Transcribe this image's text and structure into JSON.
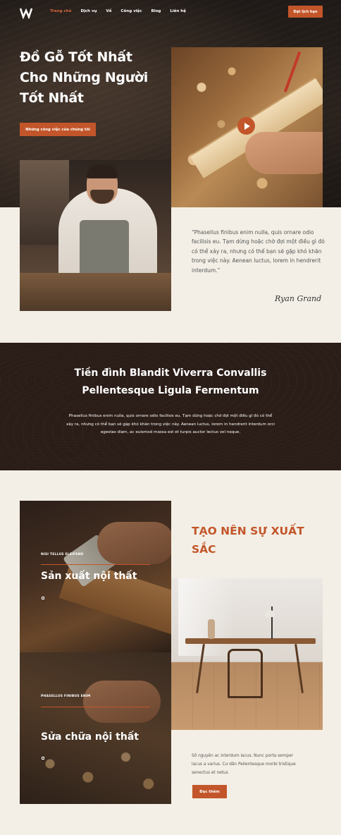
{
  "brand": {
    "logo_letter": "W",
    "accent": "#c2562a"
  },
  "nav": {
    "items": [
      {
        "label": "Trang chủ",
        "active": true
      },
      {
        "label": "Dịch vụ",
        "active": false
      },
      {
        "label": "Về",
        "active": false
      },
      {
        "label": "Công việc",
        "active": false
      },
      {
        "label": "Blog",
        "active": false
      },
      {
        "label": "Liên hệ",
        "active": false
      }
    ],
    "cta_label": "Đặt lịch hẹn"
  },
  "hero": {
    "title": "Đồ Gỗ Tốt Nhất Cho Những Người Tốt Nhất",
    "button_label": "Những công việc của chúng tôi"
  },
  "testimonial": {
    "quote": "“Phasellus finibus enim nulla, quis ornare odio facilisis eu. Tạm dừng hoặc chờ đợi một điều gì đó có thể xảy ra, nhưng có thể bạn sẽ gặp khó khăn trong việc này. Aenean luctus, lorem in hendrerit interdum.”",
    "signature": "Ryan Grand"
  },
  "band": {
    "title": "Tiền đình Blandit Viverra Convallis Pellentesque Ligula Fermentum",
    "text": "Phasellus finibus enim nulla, quis ornare odio facilisis eu. Tạm dừng hoặc chờ đợi một điều gì đó có thể xảy ra, nhưng có thể bạn sẽ gặp khó khăn trong việc này. Aenean luctus, lorem in hendrerit interdum orci egestas diam, ac euismod massa est et turpis auctor lectus vel neque."
  },
  "services": [
    {
      "kicker": "NISI TELLUS ELEIFEND",
      "title": "Sản xuất nội thất"
    },
    {
      "kicker": "PHASELLUS FINIBUS ENIM",
      "title": "Sửa chữa nội thất"
    }
  ],
  "excellence": {
    "title": "TẠO NÊN SỰ XUẤT SẮC",
    "text": "Số nguyên ac interdum lacus. Nunc porta semper lacus a varius. Cư dân Pellentesque morbi tristique senectus et netus",
    "button_label": "Đọc thêm"
  }
}
